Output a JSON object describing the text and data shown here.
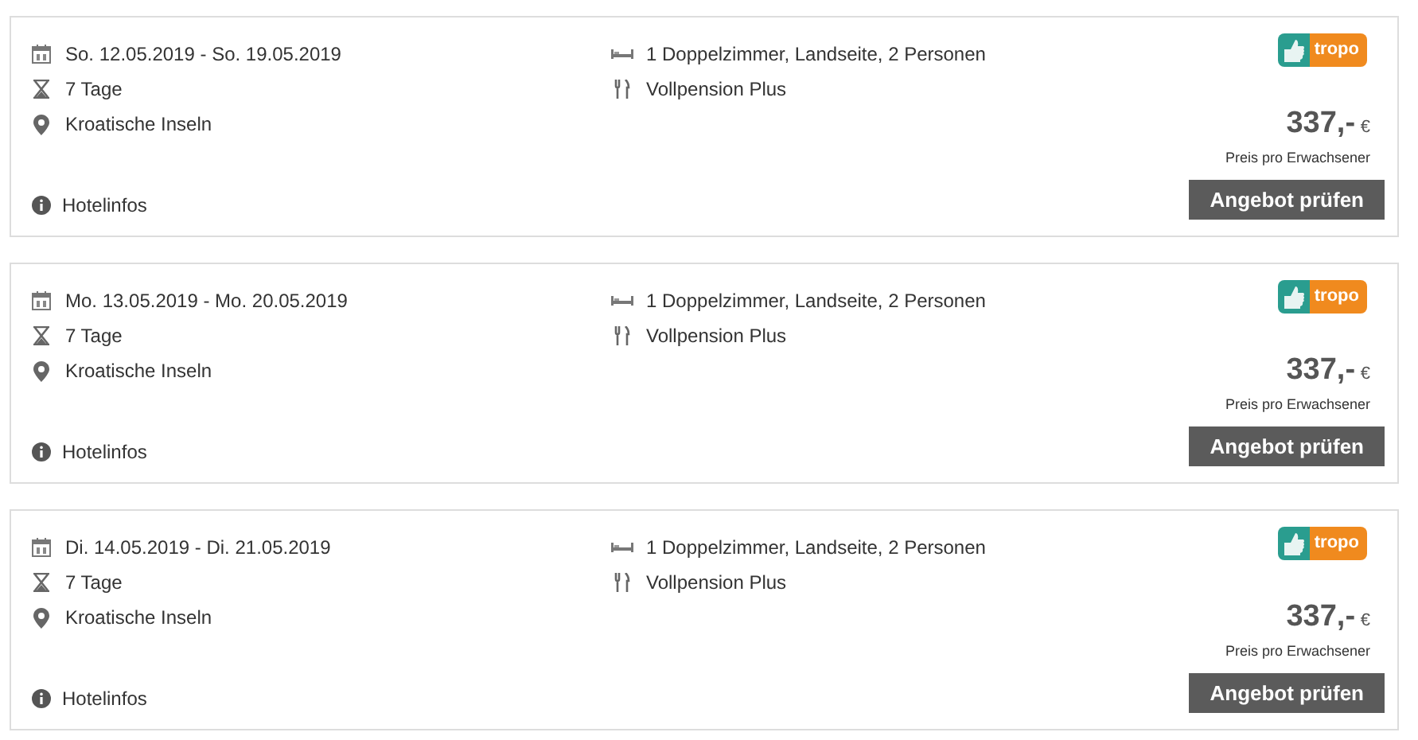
{
  "offers": [
    {
      "dates": "So. 12.05.2019 - So. 19.05.2019",
      "duration": "7 Tage",
      "region": "Kroatische Inseln",
      "room": "1 Doppelzimmer, Landseite, 2 Personen",
      "board": "Vollpension Plus",
      "operator": "tropo",
      "price": "337,-",
      "currency": "€",
      "price_note": "Preis pro Erwachsener",
      "hotel_link": "Hotelinfos",
      "button": "Angebot prüfen"
    },
    {
      "dates": "Mo. 13.05.2019 - Mo. 20.05.2019",
      "duration": "7 Tage",
      "region": "Kroatische Inseln",
      "room": "1 Doppelzimmer, Landseite, 2 Personen",
      "board": "Vollpension Plus",
      "operator": "tropo",
      "price": "337,-",
      "currency": "€",
      "price_note": "Preis pro Erwachsener",
      "hotel_link": "Hotelinfos",
      "button": "Angebot prüfen"
    },
    {
      "dates": "Di. 14.05.2019 - Di. 21.05.2019",
      "duration": "7 Tage",
      "region": "Kroatische Inseln",
      "room": "1 Doppelzimmer, Landseite, 2 Personen",
      "board": "Vollpension Plus",
      "operator": "tropo",
      "price": "337,-",
      "currency": "€",
      "price_note": "Preis pro Erwachsener",
      "hotel_link": "Hotelinfos",
      "button": "Angebot prüfen"
    }
  ]
}
